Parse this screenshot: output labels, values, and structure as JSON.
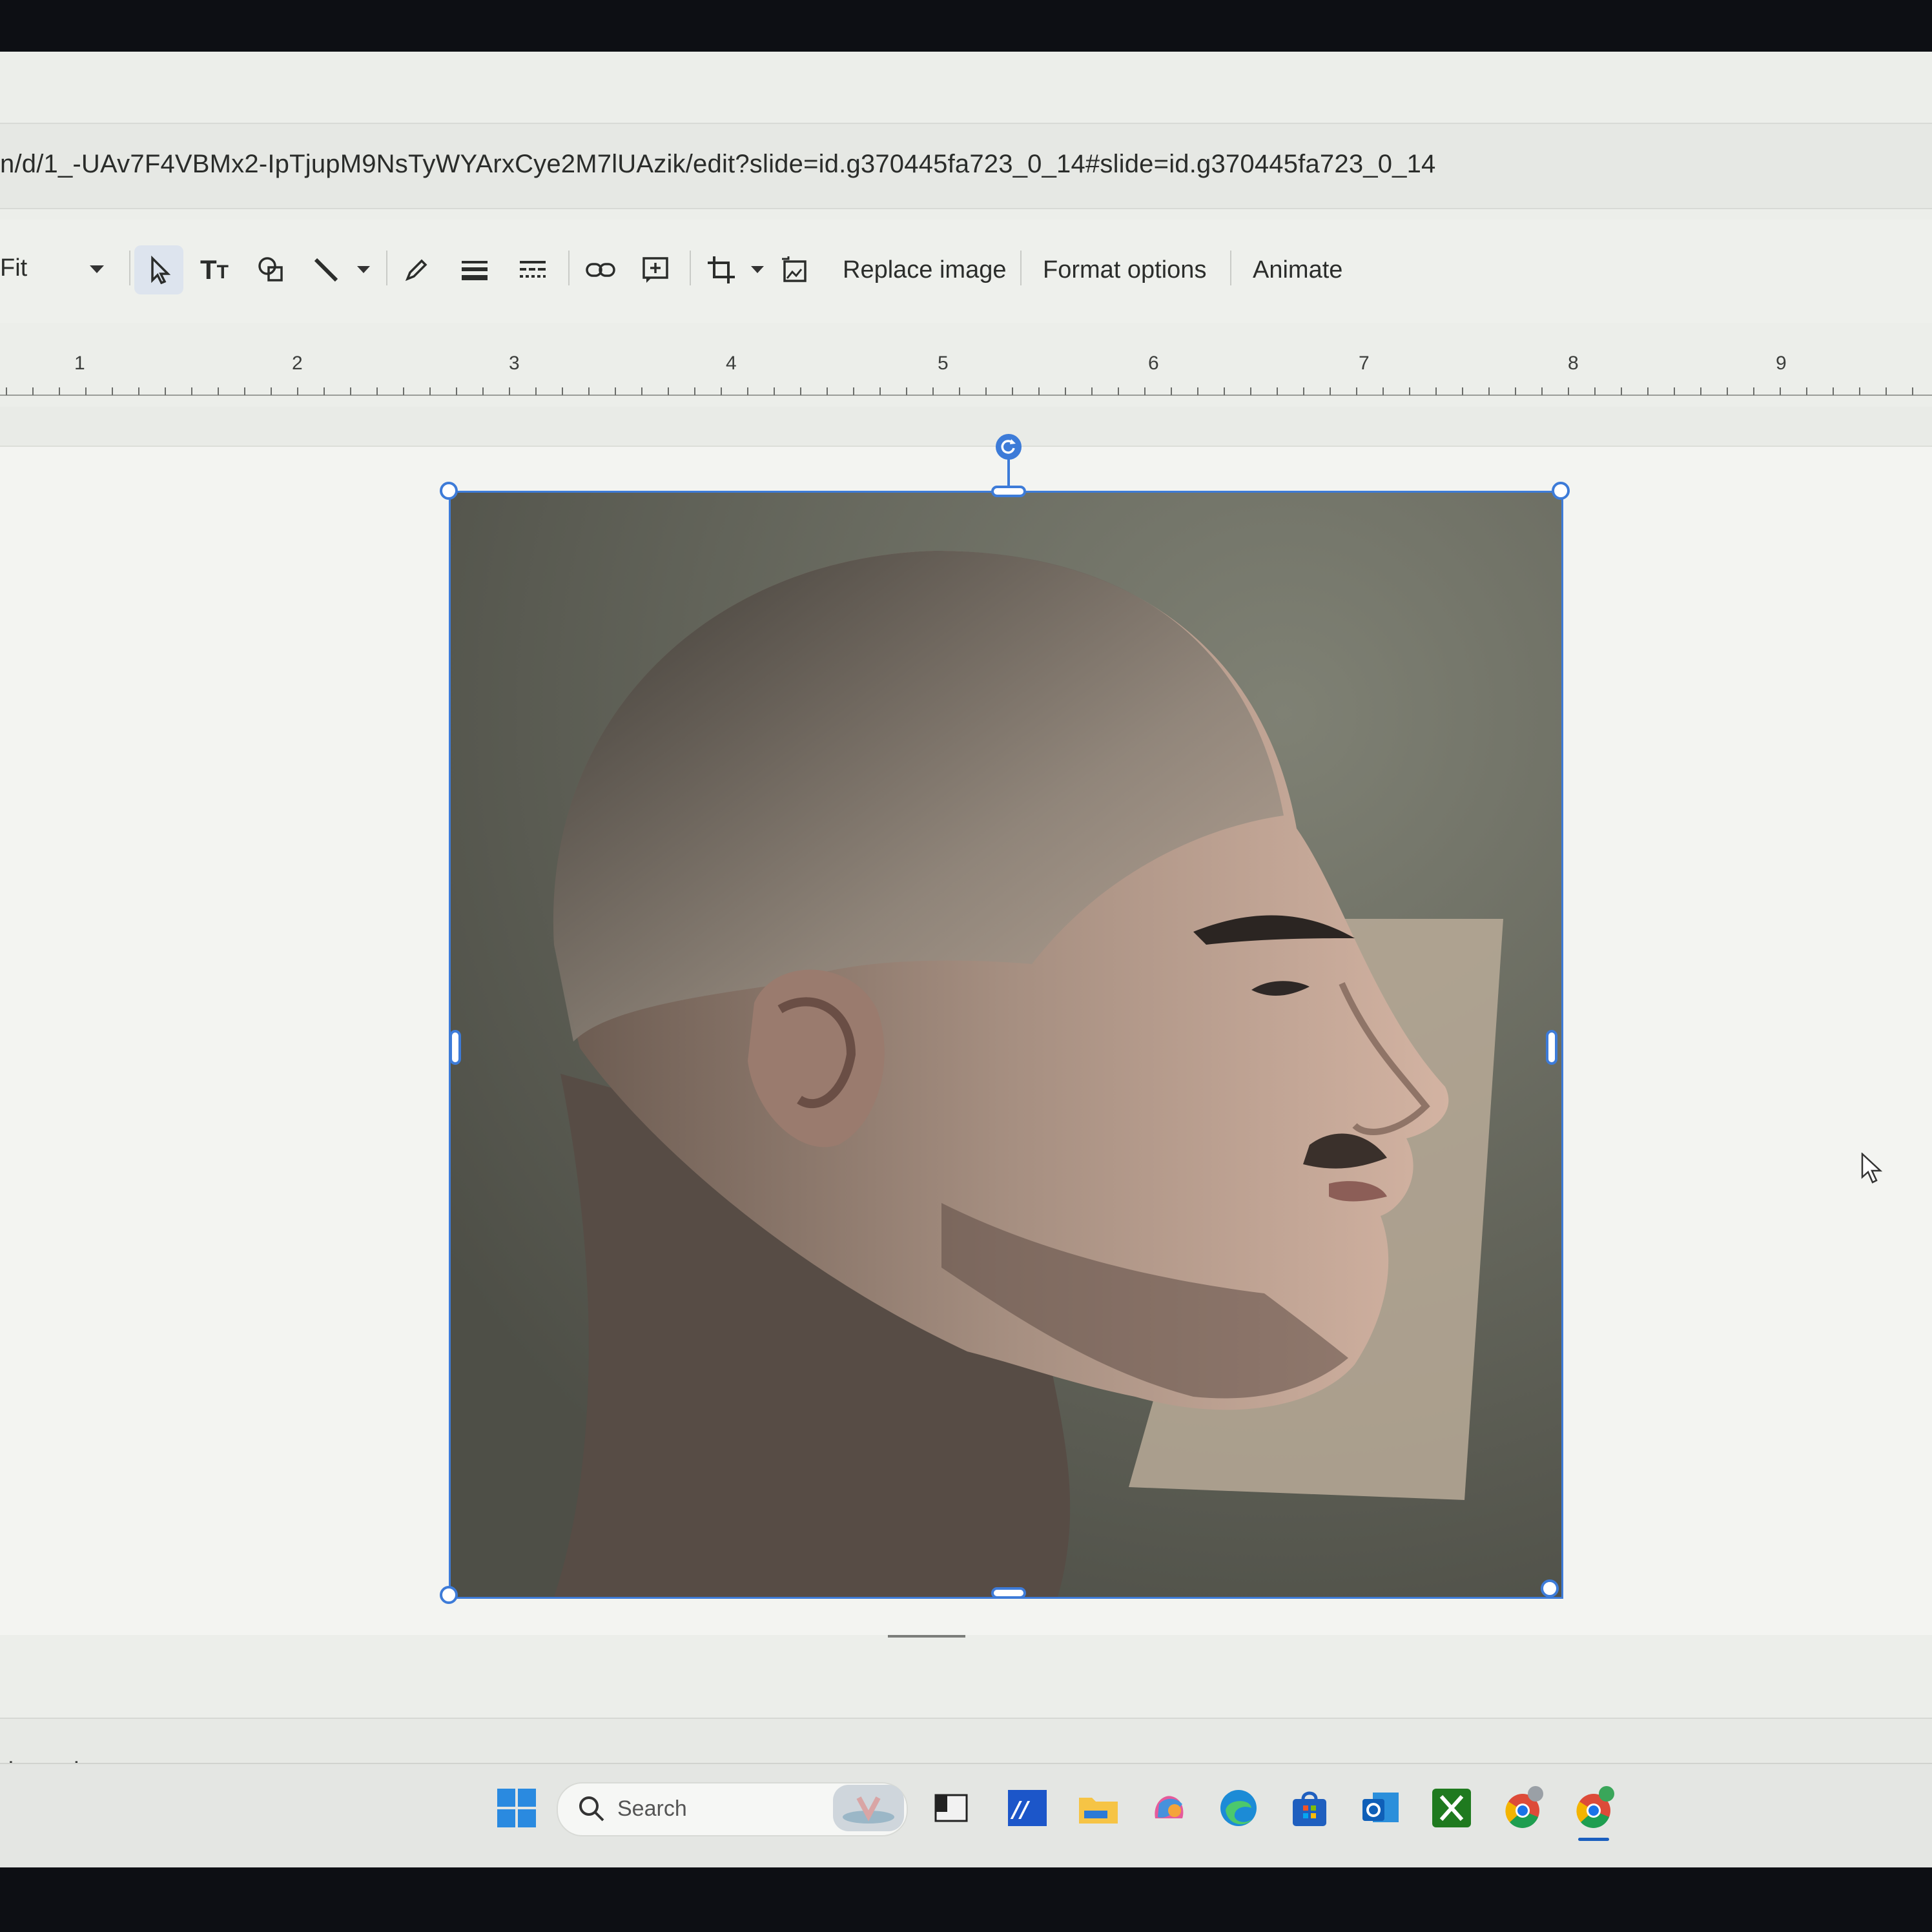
{
  "browser": {
    "url": "n/d/1_-UAv7F4VBMx2-IpTjupM9NsTyWYArxCye2M7lUAzik/edit?slide=id.g370445fa723_0_14#slide=id.g370445fa723_0_14"
  },
  "toolbar": {
    "zoom_value": "Fit",
    "replace_image": "Replace image",
    "format_options": "Format options",
    "animate": "Animate"
  },
  "ruler": {
    "ticks": [
      "1",
      "2",
      "3",
      "4",
      "5",
      "6",
      "7",
      "8",
      "9"
    ]
  },
  "notes": {
    "placeholder": "d speaker notes"
  },
  "taskbar": {
    "search_label": "Search",
    "icons": [
      "windows-start-icon",
      "search-icon",
      "widgets-icon",
      "terminal-icon",
      "tool-icon",
      "file-explorer-icon",
      "copilot-icon",
      "edge-icon",
      "store-icon",
      "outlook-icon",
      "xbox-icon",
      "chrome-profile-icon",
      "chrome-profile-m-icon"
    ]
  },
  "colors": {
    "selection": "#3d7bd8",
    "toolbar_bg": "#eef0ec",
    "canvas_bg": "#f3f4f1"
  }
}
